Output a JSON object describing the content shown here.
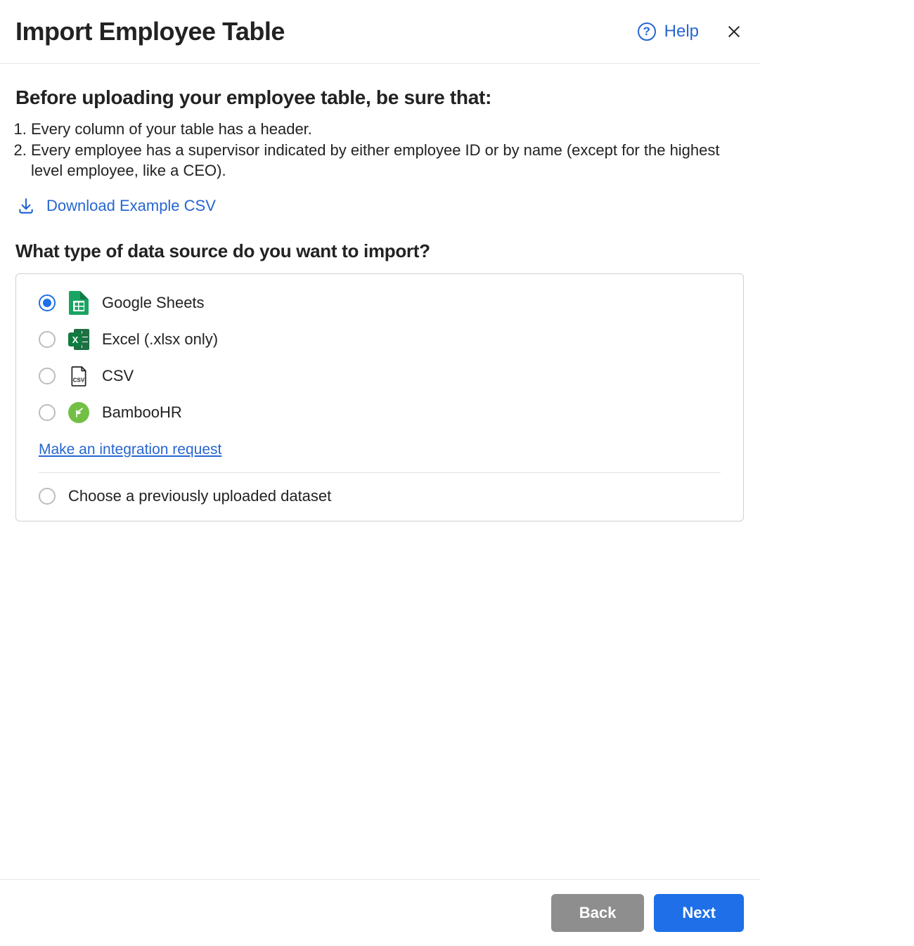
{
  "header": {
    "title": "Import Employee Table",
    "help_label": "Help"
  },
  "before": {
    "subtitle": "Before uploading your employee table, be sure that:",
    "items": [
      "Every column of your table has a header.",
      "Every employee has a supervisor indicated by either employee ID or by name (except for the highest level employee, like a CEO)."
    ]
  },
  "download_label": "Download Example CSV",
  "question": "What type of data source do you want to import?",
  "sources": [
    {
      "id": "google-sheets",
      "label": "Google Sheets",
      "selected": true
    },
    {
      "id": "excel",
      "label": "Excel (.xlsx only)",
      "selected": false
    },
    {
      "id": "csv",
      "label": "CSV",
      "selected": false
    },
    {
      "id": "bamboohr",
      "label": "BambooHR",
      "selected": false
    }
  ],
  "integration_link": "Make an integration request",
  "previous_dataset_label": "Choose a previously uploaded dataset",
  "footer": {
    "back": "Back",
    "next": "Next"
  }
}
